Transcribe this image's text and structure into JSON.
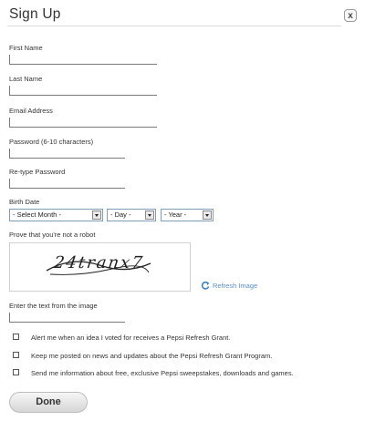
{
  "dialog": {
    "title": "Sign Up",
    "close_label": "x"
  },
  "fields": {
    "first_name": {
      "label": "First Name",
      "value": ""
    },
    "last_name": {
      "label": "Last Name",
      "value": ""
    },
    "email": {
      "label": "Email Address",
      "value": ""
    },
    "password": {
      "label": "Password (6-10 characters)",
      "value": ""
    },
    "retype_password": {
      "label": "Re-type Password",
      "value": ""
    }
  },
  "birth_date": {
    "label": "Birth Date",
    "month": "- Select Month -",
    "day": "- Day -",
    "year": "- Year -"
  },
  "captcha": {
    "label": "Prove that you're not a robot",
    "image_text": "24tranx7",
    "refresh_label": "Refresh Image",
    "input_label": "Enter the text from the image",
    "input_value": ""
  },
  "checkboxes": [
    {
      "label": "Alert me when an idea I voted for receives a Pepsi Refresh Grant.",
      "checked": false
    },
    {
      "label": "Keep me posted on news and updates about the Pepsi Refresh Grant Program.",
      "checked": false
    },
    {
      "label": "Send me information about free, exclusive Pepsi sweepstakes, downloads and games.",
      "checked": false
    }
  ],
  "actions": {
    "done_label": "Done"
  },
  "icons": {
    "close": "close-icon",
    "refresh": "refresh-icon",
    "dropdown": "chevron-down-icon"
  },
  "colors": {
    "link": "#5b8fc9",
    "field_border": "#7a7a7a",
    "select_border": "#7f9db9"
  }
}
